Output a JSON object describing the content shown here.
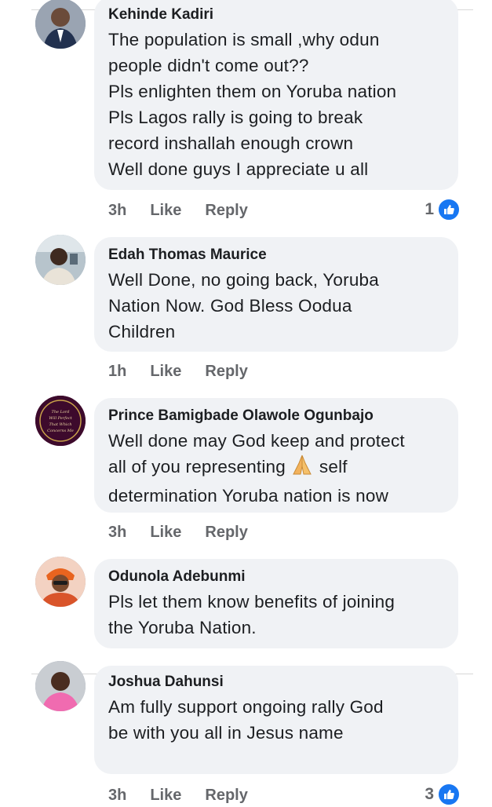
{
  "comments": [
    {
      "author": "Kehinde Kadiri",
      "lines": [
        "The population is small ,why odun",
        "people didn't come out??",
        "Pls enlighten them on Yoruba nation",
        "Pls Lagos rally is going to break",
        "record inshallah enough crown",
        "Well done guys I appreciate u all"
      ],
      "time": "3h",
      "like": "Like",
      "reply": "Reply",
      "reaction_count": "1"
    },
    {
      "author": "Edah Thomas Maurice",
      "lines": [
        "Well Done, no going back, Yoruba",
        "Nation Now. God Bless Oodua",
        "Children"
      ],
      "time": "1h",
      "like": "Like",
      "reply": "Reply"
    },
    {
      "author": "Prince Bamigbade Olawole Ogunbajo",
      "lines": [
        "Well done may God keep and protect",
        "all of you representing",
        "self",
        "determination Yoruba nation is now"
      ],
      "emoji": "folded-hands",
      "time": "3h",
      "like": "Like",
      "reply": "Reply"
    },
    {
      "author": "Odunola Adebunmi",
      "lines": [
        "Pls let them know benefits of joining",
        "the Yoruba Nation."
      ]
    },
    {
      "author": "Joshua Dahunsi",
      "lines": [
        "Am fully support ongoing rally God",
        "be with you all in Jesus name"
      ],
      "time": "3h",
      "like": "Like",
      "reply": "Reply",
      "reaction_count": "3"
    }
  ],
  "avatar_seal_text": [
    "The Lord",
    "Will Perfect",
    "That Which",
    "Concerns Me"
  ],
  "colors": {
    "bubble": "#f0f2f5",
    "meta": "#65676b",
    "like_blue": "#1877f2"
  }
}
